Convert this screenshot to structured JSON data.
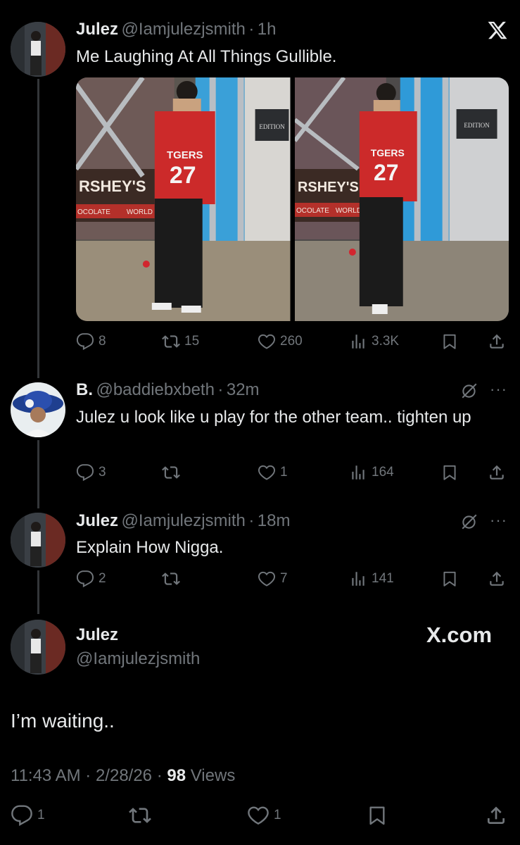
{
  "tweet": {
    "author": "Julez",
    "handle": "@Iamjulezjsmith",
    "time": "1h",
    "text": "Me Laughing At All Things Gullible.",
    "images": [
      "photo-1",
      "photo-2"
    ],
    "photo_text": {
      "sign_1": "RSHEY'S",
      "sign_2": "OCOLATE",
      "sign_3": "WORLD",
      "jersey": "27",
      "jersey_top": "TGERS",
      "plaque": "EDITION"
    },
    "stats": {
      "replies": "8",
      "reposts": "15",
      "likes": "260",
      "views": "3.3K"
    }
  },
  "reply1": {
    "author": "B.",
    "handle": "@baddiebxbeth",
    "time": "32m",
    "text": "Julez u look like u play for the other team.. tighten up",
    "stats": {
      "replies": "3",
      "reposts": "",
      "likes": "1",
      "views": "164"
    }
  },
  "reply2": {
    "author": "Julez",
    "handle": "@Iamjulezjsmith",
    "time": "18m",
    "text": "Explain How Nigga.",
    "stats": {
      "replies": "2",
      "reposts": "",
      "likes": "7",
      "views": "141"
    }
  },
  "main": {
    "author": "Julez",
    "handle": "@Iamjulezjsmith",
    "brand": "X.com",
    "text": "I’m waiting..",
    "timestamp": "11:43 AM · 2/28/26 · ",
    "views_count": "98",
    "views_label": "Views",
    "stats": {
      "replies": "1",
      "reposts": "",
      "likes": "1"
    }
  },
  "sep": "·",
  "colors": {
    "background": "#000000",
    "text": "#e7e9ea",
    "muted": "#71767b",
    "thread_line": "#333639"
  },
  "icons": [
    "x-logo-icon",
    "reply-icon",
    "repost-icon",
    "like-icon",
    "views-icon",
    "bookmark-icon",
    "share-icon",
    "grok-icon",
    "more-icon"
  ]
}
